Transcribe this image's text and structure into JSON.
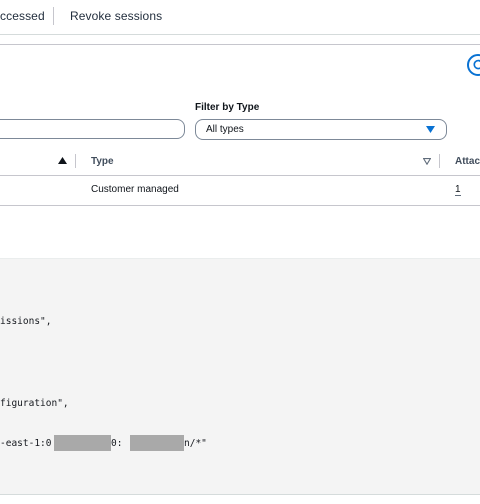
{
  "tabs": {
    "accessed_label": "ccessed",
    "revoke_label": "Revoke sessions"
  },
  "filters": {
    "filter_by_type_label": "Filter by Type",
    "type_select_value": "All types",
    "search_value": ""
  },
  "table": {
    "columns": [
      "Type",
      "Attac"
    ],
    "rows": [
      {
        "type": "Customer managed",
        "attached": "1"
      }
    ]
  },
  "code": {
    "lines": [
      "issions\",",
      "figuration\",",
      "-east-1:0",
      "0:",
      "n/*\""
    ]
  },
  "colors": {
    "accent": "#0972d3",
    "code_bg": "#f4f4f4",
    "redaction": "#a9a9a9"
  },
  "icons": {
    "refresh": "refresh-icon",
    "sort_asc": "caret-up-icon",
    "sort_desc": "caret-down-icon",
    "select_caret": "caret-down-icon"
  }
}
